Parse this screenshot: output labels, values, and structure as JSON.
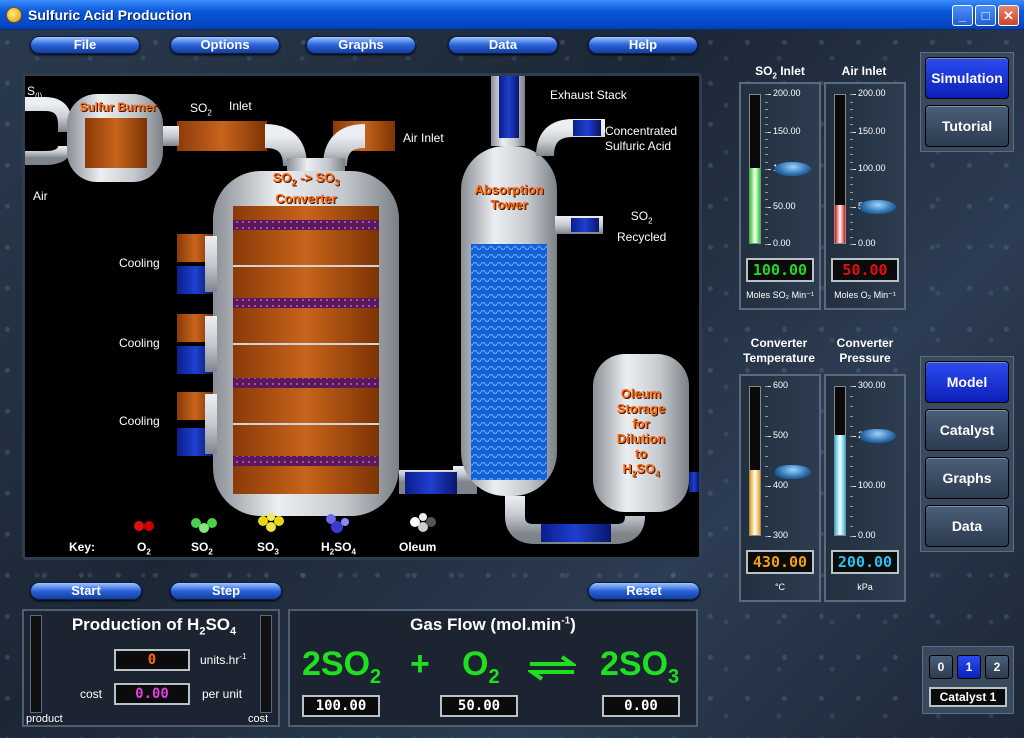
{
  "window": {
    "title": "Sulfuric Acid Production"
  },
  "menu": {
    "file": "File",
    "options": "Options",
    "graphs": "Graphs",
    "data": "Data",
    "help": "Help"
  },
  "plant": {
    "s_label": "S",
    "s_sub": "(l)",
    "air_label": "Air",
    "burner_title": "Sulfur Burner",
    "so2_label": "SO",
    "so2_sub": "2",
    "inlet_label": "Inlet",
    "air_inlet_label": "Air Inlet",
    "converter_title_1": "SO",
    "converter_sub_1": "2",
    "converter_arrow": " -> SO",
    "converter_sub_2": "3",
    "converter_title_2": "Converter",
    "cooling_labels": [
      "Cooling",
      "Cooling",
      "Cooling"
    ],
    "exhaust_label": "Exhaust Stack",
    "conc_acid_label_1": "Concentrated",
    "conc_acid_label_2": "Sulfuric Acid",
    "so2_recycled_1": "SO",
    "so2_recycled_sub": "2",
    "so2_recycled_2": "Recycled",
    "absorption_title_1": "Absorption",
    "absorption_title_2": "Tower",
    "oleum_lines": [
      "Oleum",
      "Storage",
      "for",
      "Dilution",
      "to"
    ],
    "oleum_last": "H",
    "oleum_last_sub1": "2",
    "oleum_last_mid": "SO",
    "oleum_last_sub2": "4"
  },
  "key": {
    "title": "Key:",
    "items": [
      {
        "main": "O",
        "sub": "2"
      },
      {
        "main": "SO",
        "sub": "2"
      },
      {
        "main": "SO",
        "sub": "3"
      },
      {
        "main": "H",
        "sub": "2",
        "mid": "SO",
        "sub2": "4"
      },
      {
        "main": "Oleum",
        "sub": ""
      }
    ]
  },
  "controls": {
    "start": "Start",
    "step": "Step",
    "reset": "Reset"
  },
  "gauges": {
    "so2_inlet": {
      "title": "SO",
      "title_sub": "2",
      "title_rest": " Inlet",
      "ticks": [
        "200.00",
        "150.00",
        "100.00",
        "50.00",
        "0.00"
      ],
      "value": "100.00",
      "level": 0.5,
      "unit": "Moles SO₂ Min⁻¹",
      "color": "#26d626"
    },
    "air_inlet": {
      "title": "Air Inlet",
      "ticks": [
        "200.00",
        "150.00",
        "100.00",
        "50.00",
        "0.00"
      ],
      "value": "50.00",
      "level": 0.25,
      "unit": "Moles O₂ Min⁻¹",
      "color": "#e01010"
    },
    "conv_temp": {
      "title": "Converter Temperature",
      "ticks": [
        "600",
        "500",
        "400",
        "300"
      ],
      "value": "430.00",
      "level": 0.43,
      "unit": "°C",
      "color": "#f0a010"
    },
    "conv_press": {
      "title": "Converter Pressure",
      "ticks": [
        "300.00",
        "200.00",
        "100.00",
        "0.00"
      ],
      "value": "200.00",
      "level": 0.6667,
      "unit": "kPa",
      "color": "#30c0f0"
    }
  },
  "nav_top": {
    "simulation": "Simulation",
    "tutorial": "Tutorial"
  },
  "nav_bottom": {
    "model": "Model",
    "catalyst": "Catalyst",
    "graphs": "Graphs",
    "data": "Data"
  },
  "production": {
    "title_1": "Production of H",
    "title_sub1": "2",
    "title_mid": "SO",
    "title_sub2": "4",
    "rate": "0",
    "rate_unit": "units.hr",
    "rate_unit_sup": "-1",
    "cost_label": "cost",
    "cost": "0.00",
    "cost_unit": "per unit",
    "left_label": "product",
    "right_label": "cost"
  },
  "gasflow": {
    "title": "Gas Flow (mol.min",
    "title_sup": "-1",
    "title_end": ")",
    "eq_left": "2SO",
    "eq_left_sub": "2",
    "plus": "+",
    "eq_mid": "O",
    "eq_mid_sub": "2",
    "eq_right": "2SO",
    "eq_right_sub": "3",
    "values": [
      "100.00",
      "50.00",
      "0.00"
    ]
  },
  "catalyst": {
    "options": [
      "0",
      "1",
      "2"
    ],
    "selected": "1",
    "label": "Catalyst 1"
  }
}
